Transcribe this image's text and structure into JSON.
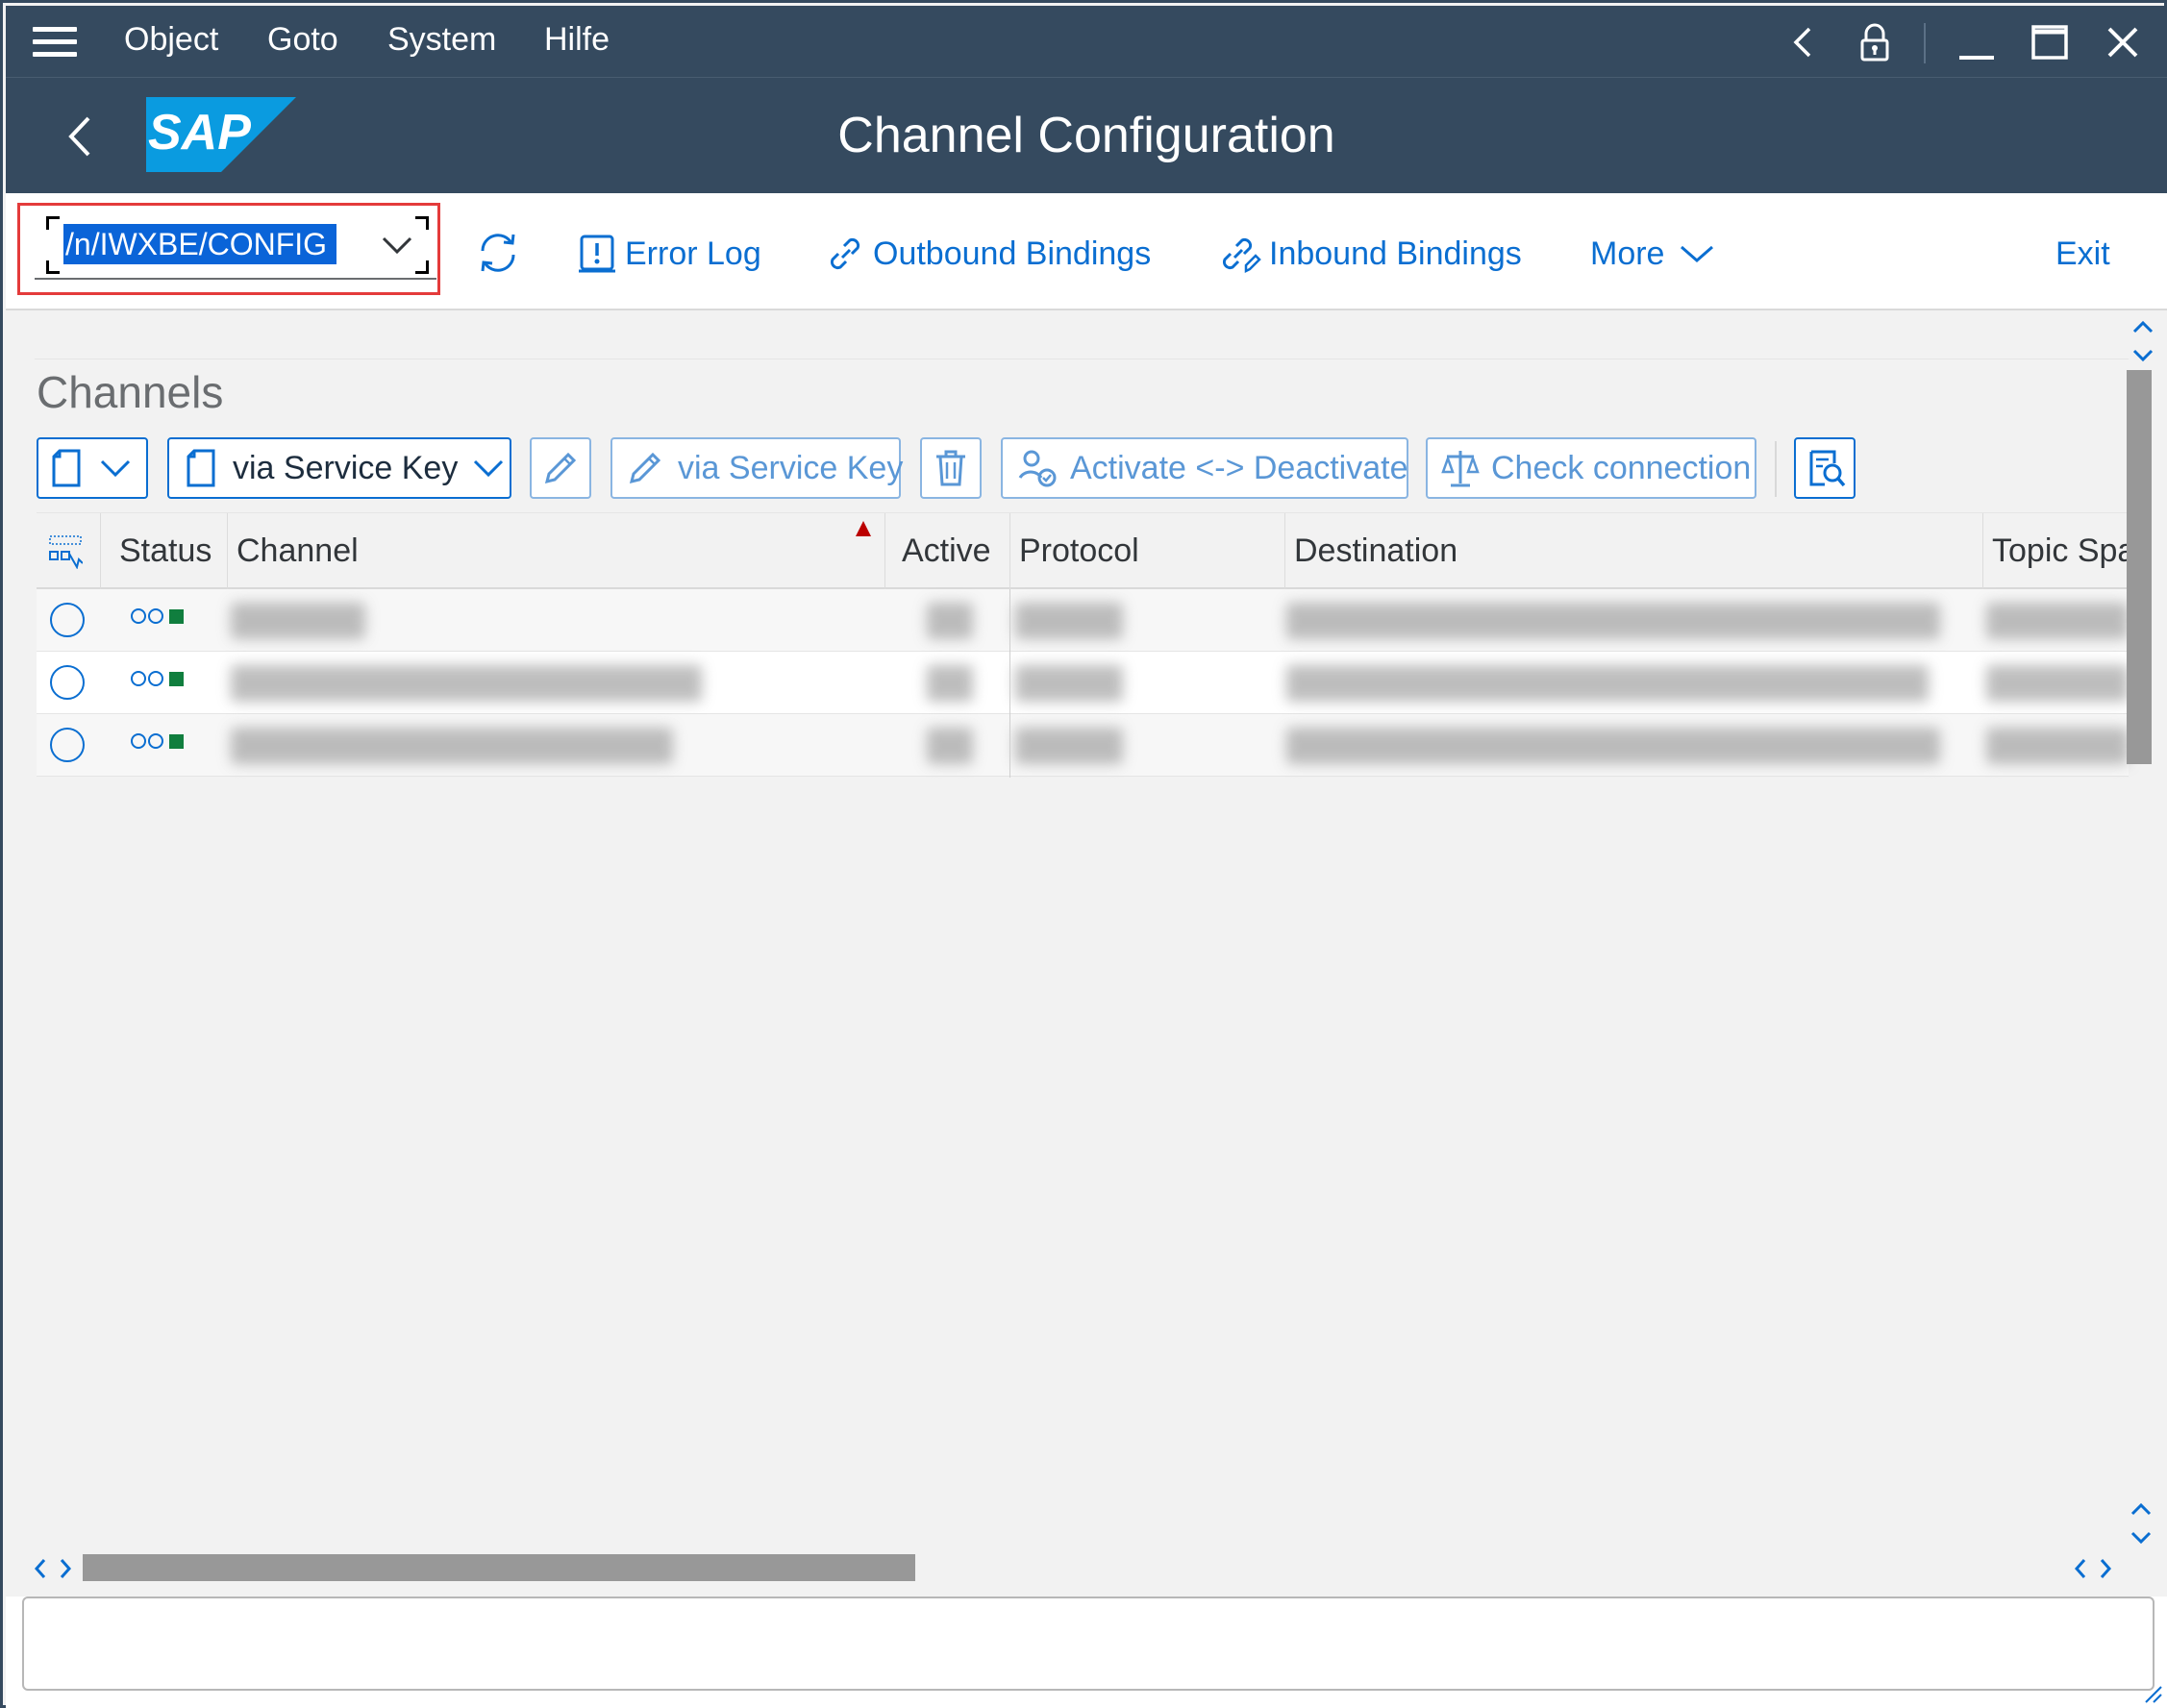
{
  "menu": {
    "items": [
      {
        "label": "Object"
      },
      {
        "label": "Goto"
      },
      {
        "label": "System"
      },
      {
        "label": "Hilfe"
      }
    ]
  },
  "header": {
    "title": "Channel Configuration",
    "logo_text": "SAP",
    "brand_color": "#0a6ed1",
    "shell_color": "#354a5f"
  },
  "toolbar": {
    "command_value": "/n/IWXBE/CONFIG",
    "error_log": "Error Log",
    "outbound_bindings": "Outbound Bindings",
    "inbound_bindings": "Inbound Bindings",
    "more": "More",
    "exit": "Exit"
  },
  "section": {
    "title": "Channels"
  },
  "actions": {
    "create_via_service_key": "via Service Key",
    "edit_via_service_key": "via Service Key",
    "activate_deactivate": "Activate <-> Deactivate",
    "check_connection": "Check connection"
  },
  "table": {
    "columns": [
      "Status",
      "Channel",
      "Active",
      "Protocol",
      "Destination",
      "Topic Space"
    ],
    "sorted_column": "Channel",
    "rows": [
      {
        "status": "inactive",
        "channel": "",
        "active": "",
        "protocol": "",
        "destination": "",
        "topic_space": ""
      },
      {
        "status": "inactive",
        "channel": "",
        "active": "",
        "protocol": "",
        "destination": "",
        "topic_space": ""
      },
      {
        "status": "inactive",
        "channel": "",
        "active": "",
        "protocol": "",
        "destination": "",
        "topic_space": ""
      }
    ]
  },
  "colors": {
    "status_green": "#107e3e",
    "highlight_red": "#e43b3b",
    "sort_indicator": "#bb0000"
  }
}
